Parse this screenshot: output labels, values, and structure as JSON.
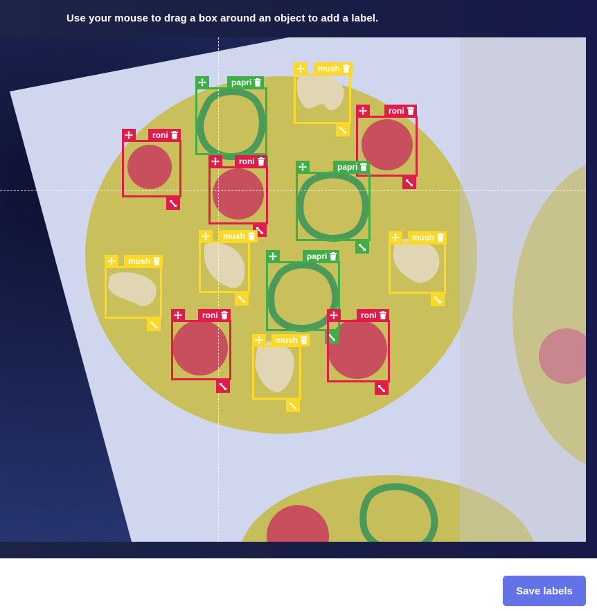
{
  "instruction": "Use your mouse to drag a box around an object to add a label.",
  "save_label": "Save labels",
  "colors": {
    "roni": "#e01c4b",
    "mush": "#fcd827",
    "papri": "#3fae49",
    "button": "#6372e6"
  },
  "icons": {
    "move": "move-arrows-icon",
    "delete": "trash-icon",
    "resize": "resize-diagonal-icon"
  },
  "labels": [
    {
      "label": "papri",
      "cls": "papri"
    },
    {
      "label": "mush",
      "cls": "mush"
    },
    {
      "label": "roni",
      "cls": "roni"
    },
    {
      "label": "roni",
      "cls": "roni"
    },
    {
      "label": "roni",
      "cls": "roni"
    },
    {
      "label": "papri",
      "cls": "papri"
    },
    {
      "label": "mush",
      "cls": "mush"
    },
    {
      "label": "mush",
      "cls": "mush"
    },
    {
      "label": "mush",
      "cls": "mush"
    },
    {
      "label": "papri",
      "cls": "papri"
    },
    {
      "label": "roni",
      "cls": "roni"
    },
    {
      "label": "mush",
      "cls": "mush"
    },
    {
      "label": "roni",
      "cls": "roni"
    }
  ]
}
